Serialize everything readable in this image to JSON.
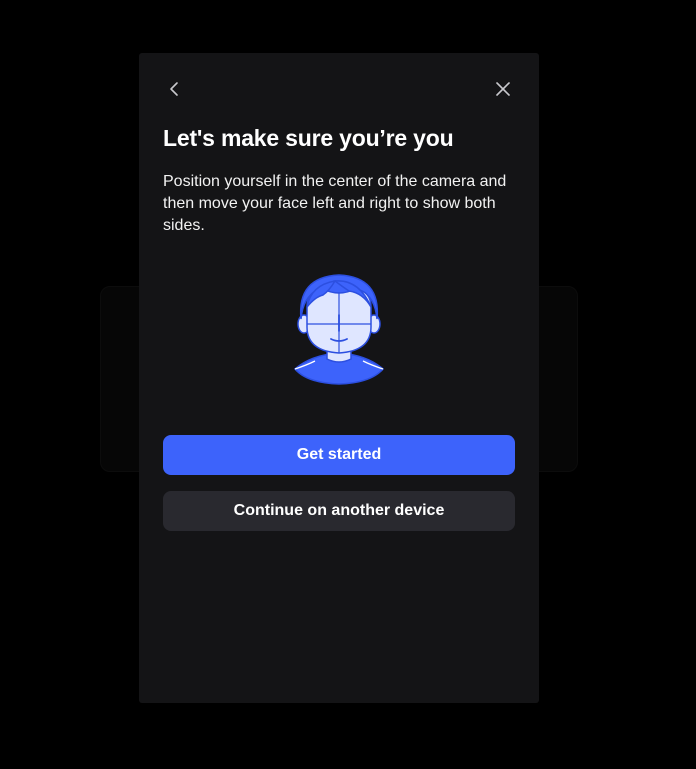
{
  "modal": {
    "back_icon": "chevron-left-icon",
    "close_icon": "close-icon",
    "title": "Let's make sure you’re you",
    "description": "Position yourself in the center of the camera and then move your face left and right to show both sides.",
    "illustration_icon": "face-scan-icon",
    "primary_button": "Get started",
    "secondary_button": "Continue on another device"
  },
  "colors": {
    "overlay": "#000000",
    "modal_bg": "#141416",
    "primary": "#3d63fb",
    "secondary": "#29292f",
    "text": "#ffffff"
  }
}
